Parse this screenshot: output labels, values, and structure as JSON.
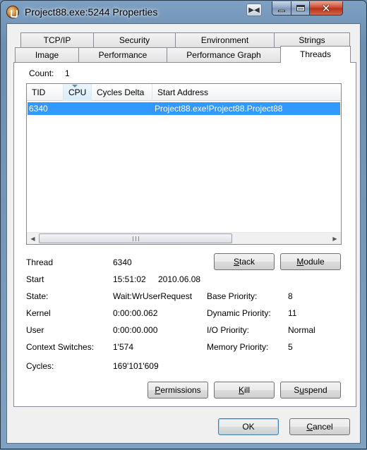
{
  "window": {
    "title": "Project88.exe:5244 Properties",
    "app_icon": "process-explorer-icon",
    "controls": {
      "minimize": "minimize-icon",
      "maximize": "maximize-icon",
      "close": "close-icon"
    }
  },
  "tabs": {
    "row1": [
      "TCP/IP",
      "Security",
      "Environment",
      "Strings"
    ],
    "row2": [
      "Image",
      "Performance",
      "Performance Graph",
      "Threads"
    ],
    "active": "Threads"
  },
  "threads": {
    "count_label": "Count:",
    "count_value": "1",
    "columns": [
      "TID",
      "CPU",
      "Cycles Delta",
      "Start Address"
    ],
    "sorted_column": "CPU",
    "rows": [
      {
        "tid": "6340",
        "cpu": "",
        "cycles_delta": "",
        "start_address": "Project88.exe!Project88.Project88"
      }
    ]
  },
  "details": {
    "thread_label": "Thread",
    "thread_value": "6340",
    "start_label": "Start",
    "start_time": "15:51:02",
    "start_date": "2010.06.08",
    "state_label": "State:",
    "state_value": "Wait:WrUserRequest",
    "kernel_label": "Kernel",
    "kernel_value": "0:00:00.062",
    "user_label": "User",
    "user_value": "0:00:00.000",
    "ctx_label": "Context Switches:",
    "ctx_value": "1'574",
    "cycles_label": "Cycles:",
    "cycles_value": "169'101'609",
    "base_priority_label": "Base Priority:",
    "base_priority_value": "8",
    "dynamic_priority_label": "Dynamic Priority:",
    "dynamic_priority_value": "11",
    "io_priority_label": "I/O Priority:",
    "io_priority_value": "Normal",
    "memory_priority_label": "Memory Priority:",
    "memory_priority_value": "5"
  },
  "buttons": {
    "stack": {
      "acc": "S",
      "rest": "tack"
    },
    "module": {
      "acc": "M",
      "rest": "odule"
    },
    "permissions": {
      "acc": "P",
      "rest": "ermissions"
    },
    "kill": {
      "acc": "K",
      "rest": "ill"
    },
    "suspend": {
      "pre": "S",
      "acc": "u",
      "rest": "spend"
    },
    "ok": "OK",
    "cancel": {
      "acc": "C",
      "rest": "ancel"
    }
  }
}
